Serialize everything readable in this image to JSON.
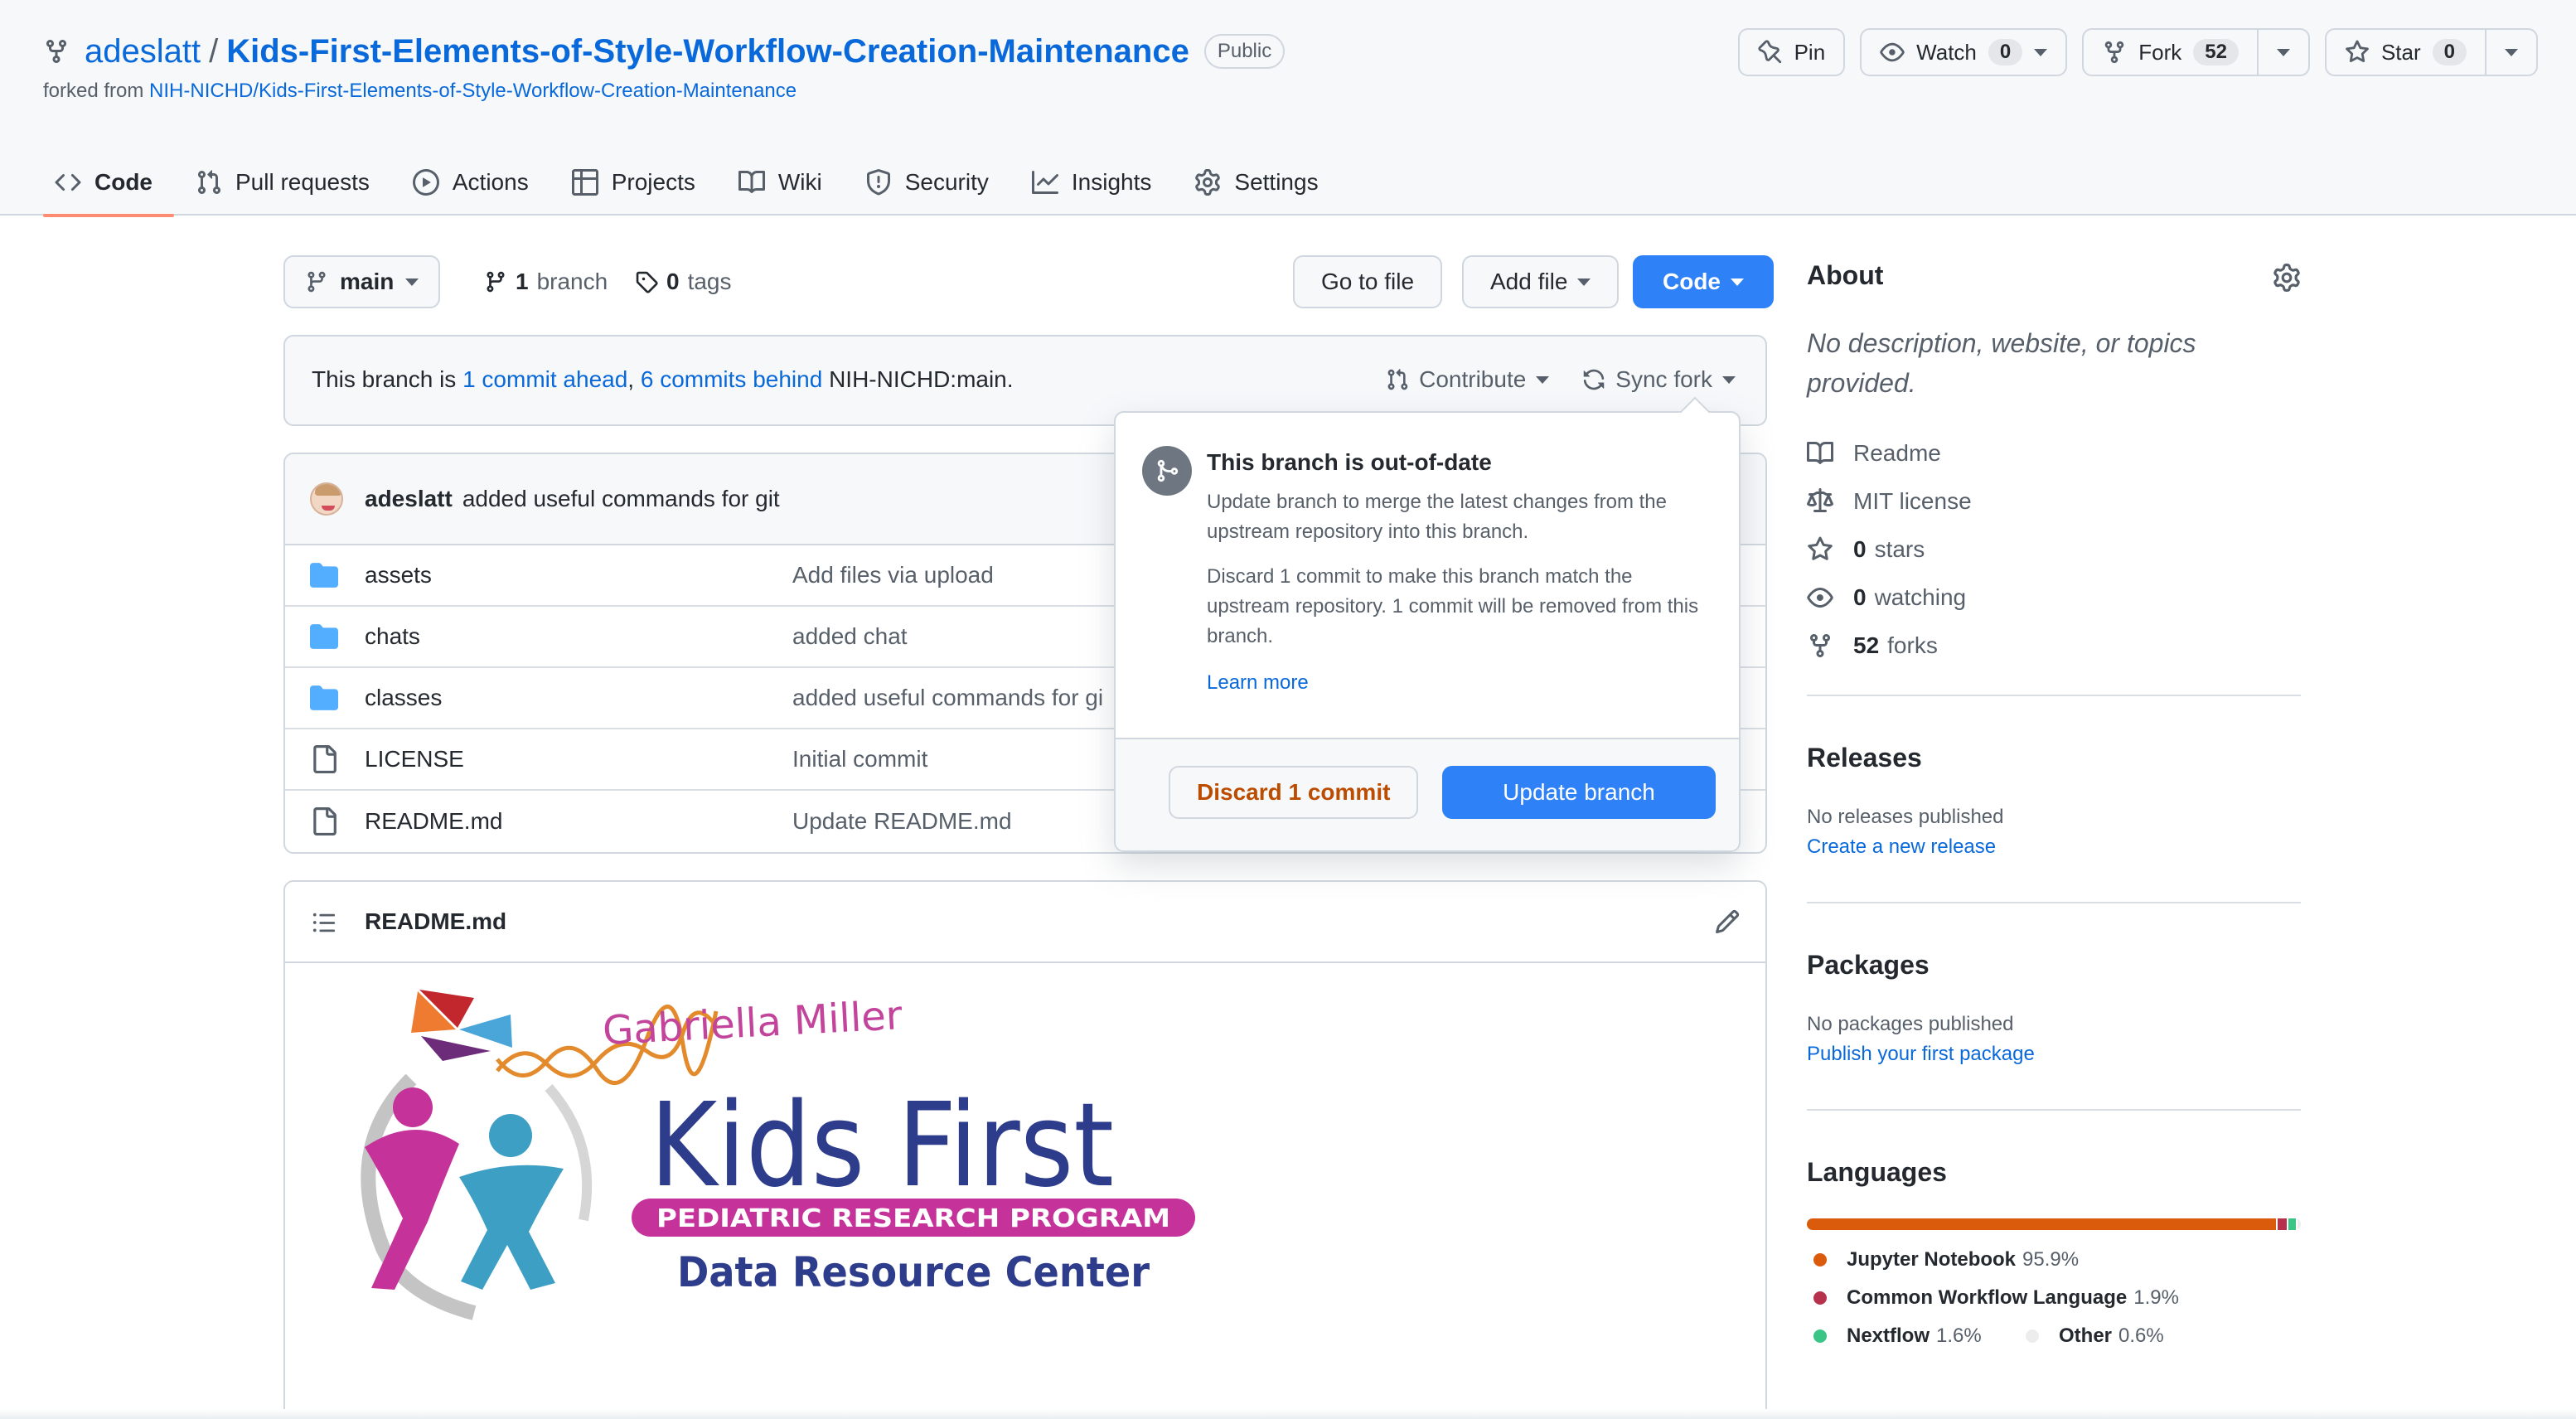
{
  "repo": {
    "owner": "adeslatt",
    "separator": "/",
    "name": "Kids-First-Elements-of-Style-Workflow-Creation-Maintenance",
    "visibility": "Public",
    "forked_from_prefix": "forked from",
    "forked_from": "NIH-NICHD/Kids-First-Elements-of-Style-Workflow-Creation-Maintenance"
  },
  "header_actions": {
    "pin": "Pin",
    "watch": "Watch",
    "watch_count": "0",
    "fork": "Fork",
    "fork_count": "52",
    "star": "Star",
    "star_count": "0"
  },
  "tabs": [
    {
      "label": "Code",
      "icon": "code-icon"
    },
    {
      "label": "Pull requests",
      "icon": "git-pull-request-icon"
    },
    {
      "label": "Actions",
      "icon": "play-icon"
    },
    {
      "label": "Projects",
      "icon": "table-icon"
    },
    {
      "label": "Wiki",
      "icon": "book-icon"
    },
    {
      "label": "Security",
      "icon": "shield-icon"
    },
    {
      "label": "Insights",
      "icon": "graph-icon"
    },
    {
      "label": "Settings",
      "icon": "gear-icon"
    }
  ],
  "toolbar": {
    "branch": "main",
    "branch_count": "1",
    "branch_label": "branch",
    "tag_count": "0",
    "tag_label": "tags",
    "go_to_file": "Go to file",
    "add_file": "Add file",
    "code": "Code"
  },
  "fork_status": {
    "prefix": "This branch is",
    "ahead": "1 commit ahead",
    "comma": ",",
    "behind": "6 commits behind",
    "upstream": "NIH-NICHD:main.",
    "contribute": "Contribute",
    "sync_fork": "Sync fork"
  },
  "latest_commit": {
    "author": "adeslatt",
    "message": "added useful commands for git"
  },
  "files": [
    {
      "name": "assets",
      "type": "folder",
      "message": "Add files via upload"
    },
    {
      "name": "chats",
      "type": "folder",
      "message": "added chat"
    },
    {
      "name": "classes",
      "type": "folder",
      "message": "added useful commands for gi"
    },
    {
      "name": "LICENSE",
      "type": "file",
      "message": "Initial commit"
    },
    {
      "name": "README.md",
      "type": "file",
      "message": "Update README.md"
    }
  ],
  "readme": {
    "title": "README.md",
    "logo": {
      "top_text": "Gabriella Miller",
      "main_text": "Kids First",
      "banner_text": "PEDIATRIC RESEARCH PROGRAM",
      "bottom_text": "Data Resource Center"
    }
  },
  "sync_popover": {
    "title": "This branch is out-of-date",
    "text1": "Update branch to merge the latest changes from the upstream repository into this branch.",
    "text2": "Discard 1 commit to make this branch match the upstream repository. 1 commit will be removed from this branch.",
    "learn_more": "Learn more",
    "discard": "Discard 1 commit",
    "update": "Update branch"
  },
  "about": {
    "heading": "About",
    "description": "No description, website, or topics provided.",
    "readme": "Readme",
    "license": "MIT license",
    "stars_count": "0",
    "stars_label": "stars",
    "watching_count": "0",
    "watching_label": "watching",
    "forks_count": "52",
    "forks_label": "forks"
  },
  "releases": {
    "heading": "Releases",
    "empty": "No releases published",
    "link": "Create a new release"
  },
  "packages": {
    "heading": "Packages",
    "empty": "No packages published",
    "link": "Publish your first package"
  },
  "languages": {
    "heading": "Languages",
    "items": [
      {
        "name": "Jupyter Notebook",
        "percent": "95.9%",
        "value": 95.9,
        "color": "#da5b0b"
      },
      {
        "name": "Common Workflow Language",
        "percent": "1.9%",
        "value": 1.9,
        "color": "#b5314c"
      },
      {
        "name": "Nextflow",
        "percent": "1.6%",
        "value": 1.6,
        "color": "#3ac486"
      },
      {
        "name": "Other",
        "percent": "0.6%",
        "value": 0.6,
        "color": "#ededed"
      }
    ]
  },
  "colors": {
    "link": "#0969da",
    "primary_button": "#2f81f7",
    "tab_underline": "#fd8c73",
    "discard_text": "#bc4c00"
  }
}
